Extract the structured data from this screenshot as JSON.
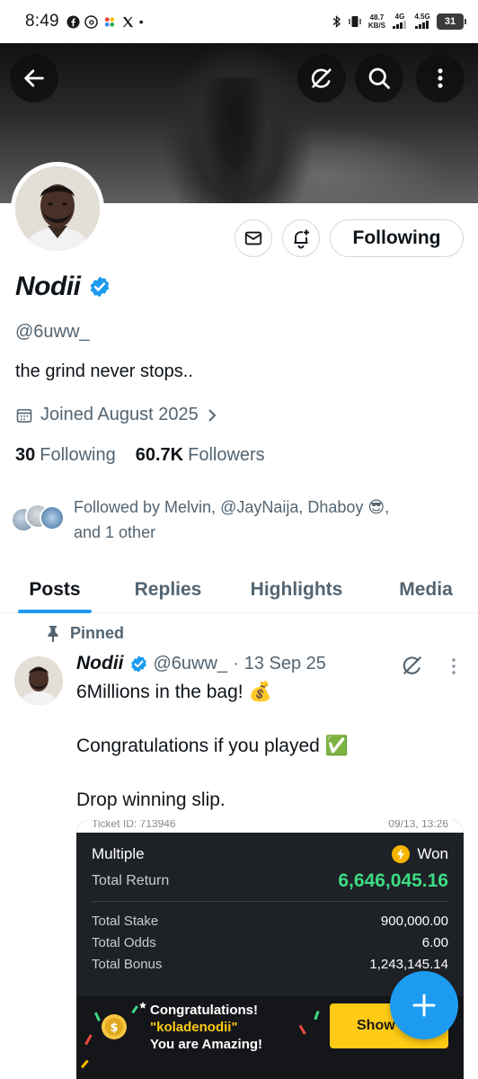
{
  "status_bar": {
    "time": "8:49",
    "network_speed_value": "48.7",
    "network_speed_unit": "KB/S",
    "signal1_label": "4G",
    "signal2_label": "4.5G",
    "battery_level": "31"
  },
  "banner": {
    "back_icon": "arrow-left-icon",
    "grok_icon": "grok-icon",
    "search_icon": "search-icon",
    "more_icon": "more-vertical-icon"
  },
  "profile": {
    "display_name": "Nodii",
    "verified": true,
    "handle": "@6uww_",
    "bio": "the grind never stops..",
    "joined": "Joined August 2025",
    "following_count": "30",
    "following_label": "Following",
    "followers_count": "60.7K",
    "followers_label": "Followers",
    "followed_by_line1": "Followed by Melvin, @JayNaija, Dhaboy 😎,",
    "followed_by_line2": "and 1 other",
    "follow_button_label": "Following"
  },
  "tabs": [
    {
      "label": "Posts",
      "active": true
    },
    {
      "label": "Replies",
      "active": false
    },
    {
      "label": "Highlights",
      "active": false
    },
    {
      "label": "Media",
      "active": false
    }
  ],
  "post": {
    "pinned_label": "Pinned",
    "author_name": "Nodii",
    "author_handle": "@6uww_",
    "separator": "·",
    "date": "13 Sep 25",
    "line1": "6Millions in the bag! 💰",
    "line2": "Congratulations if you played ✅",
    "line3": "Drop winning slip."
  },
  "slip": {
    "ticket_id": "Ticket ID: 713946",
    "ticket_date": "09/13, 13:26",
    "type": "Multiple",
    "status": "Won",
    "total_return_label": "Total Return",
    "total_return_value": "6,646,045.16",
    "total_stake_label": "Total Stake",
    "total_stake_value": "900,000.00",
    "total_odds_label": "Total Odds",
    "total_odds_value": "6.00",
    "total_bonus_label": "Total Bonus",
    "total_bonus_value": "1,243,145.14",
    "promo_line1": "Congratulations!",
    "promo_line2": "\"koladenodii\"",
    "promo_line3": "You are Amazing!",
    "show_button": "Show"
  },
  "colors": {
    "accent": "#1d9bf0",
    "text_primary": "#0f1419",
    "text_secondary": "#536471",
    "won_green": "#3ddc84",
    "promo_yellow": "#ffcb14"
  }
}
